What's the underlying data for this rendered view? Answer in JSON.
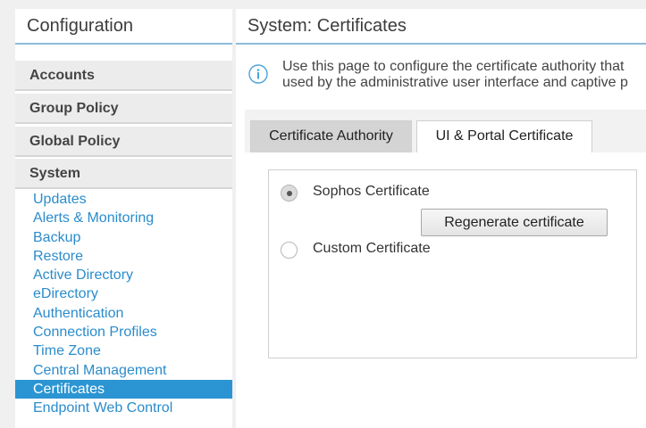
{
  "sidebar": {
    "title": "Configuration",
    "sections": [
      "Accounts",
      "Group Policy",
      "Global Policy",
      "System"
    ],
    "items": [
      {
        "label": "Updates"
      },
      {
        "label": "Alerts & Monitoring"
      },
      {
        "label": "Backup"
      },
      {
        "label": "Restore"
      },
      {
        "label": "Active Directory"
      },
      {
        "label": "eDirectory"
      },
      {
        "label": "Authentication"
      },
      {
        "label": "Connection Profiles"
      },
      {
        "label": "Time Zone"
      },
      {
        "label": "Central Management"
      },
      {
        "label": "Certificates",
        "active": true
      },
      {
        "label": "Endpoint Web Control"
      }
    ]
  },
  "main": {
    "title": "System: Certificates",
    "info_line1": "Use this page to configure the certificate authority that",
    "info_line2": "used by the administrative user interface and captive p",
    "tabs": [
      {
        "label": "Certificate Authority",
        "active": true
      },
      {
        "label": "UI & Portal Certificate",
        "active": false
      }
    ],
    "options": [
      {
        "label": "Sophos Certificate",
        "checked": true
      },
      {
        "label": "Custom Certificate",
        "checked": false
      }
    ],
    "regenerate_label": "Regenerate certificate"
  },
  "colors": {
    "accent": "#2b95d3",
    "link": "#2a8ccc",
    "title_underline": "#8dbbd9"
  }
}
